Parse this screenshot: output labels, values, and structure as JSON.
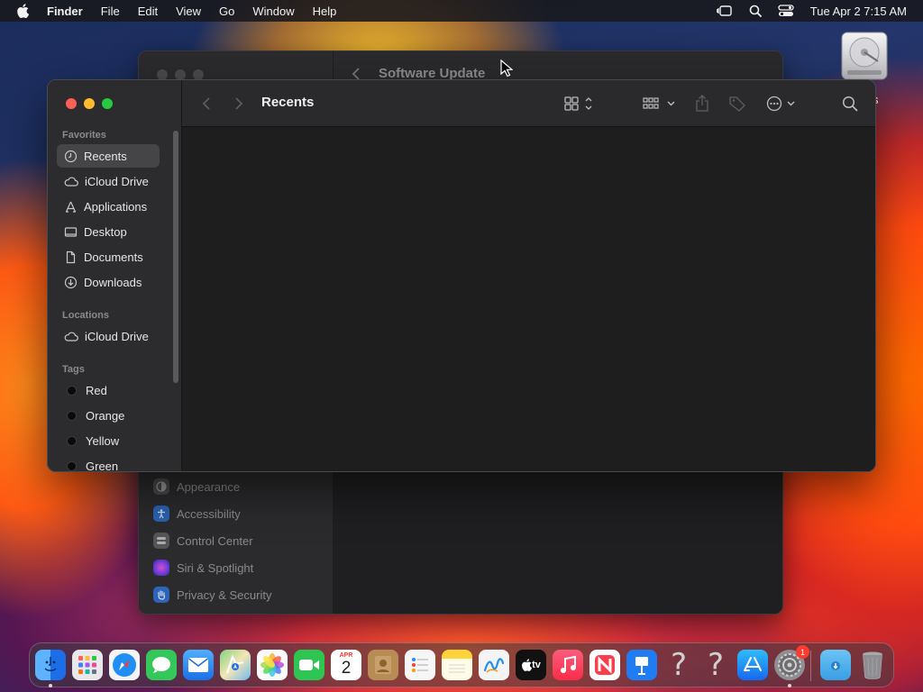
{
  "menubar": {
    "app": "Finder",
    "items": [
      "File",
      "Edit",
      "View",
      "Go",
      "Window",
      "Help"
    ],
    "clock": "Tue Apr 2  7:15 AM"
  },
  "desktop": {
    "disk_label": "s"
  },
  "settings_window": {
    "title": "Software Update",
    "sidebar_items": [
      {
        "label": "Appearance",
        "icon": "appearance-icon",
        "color": "#5a5a5c"
      },
      {
        "label": "Accessibility",
        "icon": "accessibility-icon",
        "color": "#1e7cf2"
      },
      {
        "label": "Control Center",
        "icon": "control-center-icon",
        "color": "#6e6e70"
      },
      {
        "label": "Siri & Spotlight",
        "icon": "siri-icon",
        "color": "#b04ad8"
      },
      {
        "label": "Privacy & Security",
        "icon": "hand-icon",
        "color": "#3b82f6"
      }
    ]
  },
  "finder": {
    "title": "Recents",
    "sidebar": {
      "favorites_header": "Favorites",
      "favorites": [
        {
          "label": "Recents",
          "icon": "clock-icon",
          "selected": true
        },
        {
          "label": "iCloud Drive",
          "icon": "cloud-icon"
        },
        {
          "label": "Applications",
          "icon": "applications-icon"
        },
        {
          "label": "Desktop",
          "icon": "desktop-icon"
        },
        {
          "label": "Documents",
          "icon": "document-icon"
        },
        {
          "label": "Downloads",
          "icon": "download-icon"
        }
      ],
      "locations_header": "Locations",
      "locations": [
        {
          "label": "iCloud Drive",
          "icon": "cloud-icon"
        }
      ],
      "tags_header": "Tags",
      "tags": [
        {
          "label": "Red"
        },
        {
          "label": "Orange"
        },
        {
          "label": "Yellow"
        },
        {
          "label": "Green"
        }
      ]
    }
  },
  "dock": {
    "items": [
      {
        "name": "finder",
        "color": "#2b7ff0",
        "running": true
      },
      {
        "name": "launchpad",
        "color": "#e0e0e0"
      },
      {
        "name": "safari",
        "color": "#1f8ff5"
      },
      {
        "name": "messages",
        "color": "#34c759"
      },
      {
        "name": "mail",
        "color": "#2f86f3"
      },
      {
        "name": "maps",
        "color": "#48b85a"
      },
      {
        "name": "photos",
        "color": "#f6f6f6"
      },
      {
        "name": "facetime",
        "color": "#2fc552"
      },
      {
        "name": "calendar",
        "color": "#ffffff",
        "month": "APR",
        "day": "2"
      },
      {
        "name": "contacts",
        "color": "#b89462"
      },
      {
        "name": "reminders",
        "color": "#f8f8f8"
      },
      {
        "name": "notes",
        "color": "#ffd43b"
      },
      {
        "name": "freeform",
        "color": "#f5f5f5"
      },
      {
        "name": "tv",
        "color": "#111111",
        "label": "tv"
      },
      {
        "name": "music",
        "color": "#fb3a55"
      },
      {
        "name": "news",
        "color": "#ffffff"
      },
      {
        "name": "keynote",
        "color": "#1f7cf2"
      },
      {
        "name": "unknown-app-1",
        "color": "transparent",
        "label": "?"
      },
      {
        "name": "unknown-app-2",
        "color": "transparent",
        "label": "?"
      },
      {
        "name": "app-store",
        "color": "#1c8cf6"
      },
      {
        "name": "system-settings",
        "color": "#8e8e93",
        "badge": "1",
        "running": true
      },
      {
        "name": "downloads-folder",
        "color": "#3aa0e8"
      },
      {
        "name": "trash",
        "color": "transparent"
      }
    ]
  }
}
